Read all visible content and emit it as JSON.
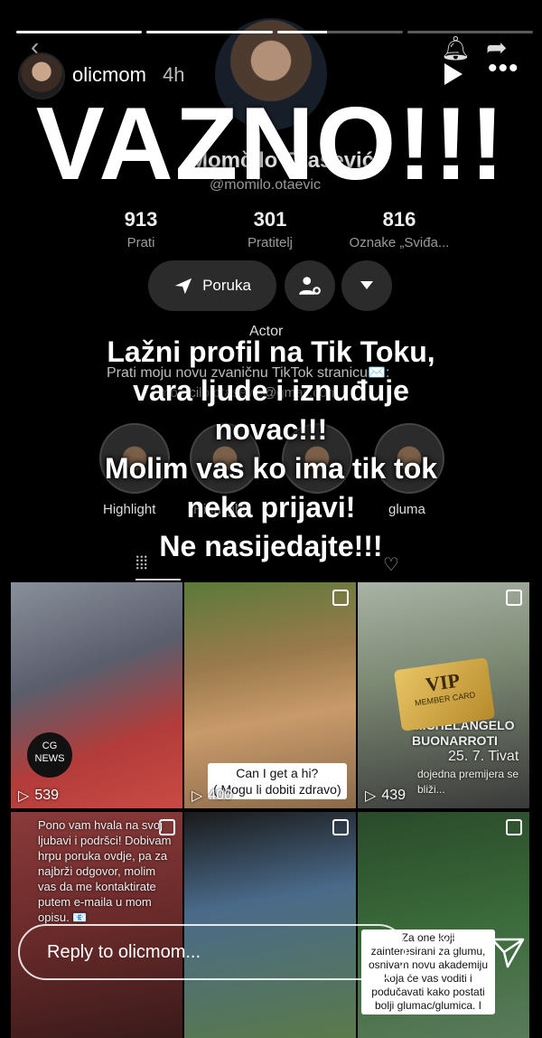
{
  "story": {
    "username": "olicmom",
    "time": "4h",
    "progress": [
      1,
      1,
      0.4,
      0
    ],
    "reply_placeholder": "Reply to olicmom..."
  },
  "overlay": {
    "title": "VAZNO!!!",
    "lines": [
      "Lažni profil na Tik Toku,",
      "vara ljude i iznuđuje",
      "novac!!!",
      "Molim vas ko ima tik tok",
      "neka prijavi!",
      "Ne nasijedajte!!!"
    ]
  },
  "tiktok_profile": {
    "name": "Momčilo Otašević",
    "handle": "@momilo.otaevic",
    "stats": [
      {
        "num": "913",
        "label": "Prati"
      },
      {
        "num": "301",
        "label": "Pratitelj"
      },
      {
        "num": "816",
        "label": "Oznake „Sviđa..."
      }
    ],
    "message_label": "Poruka",
    "category": "Actor",
    "bio": "Prati moju novu zvaničnu TikTok stranicu✉️:",
    "bio_link": "momcilo.otasevic@gmail.com",
    "highlights": [
      "Highlight",
      "Highlight",
      "",
      "gluma"
    ]
  },
  "grid": {
    "tiles": [
      {
        "views": "539"
      },
      {
        "views": "400",
        "caption": [
          "Can I get a hi?",
          "( Mogu li dobiti zdravo)"
        ]
      },
      {
        "views": "439",
        "card_title": "VIP",
        "card_sub": "MEMBER CARD",
        "sign": [
          "MICHELANGELO",
          "BUONARROTI"
        ],
        "footer": "25. 7. Tivat",
        "footer2": "dojedna premijera se bliži..."
      },
      {
        "caption": [
          "Pono vam hvala na svoj",
          "ljubavi i podršci! Dobivam",
          "hrpu poruka ovdje, pa za",
          "najbrži odgovor, molim",
          "vas da me kontaktirate",
          "putem e-maila u mom",
          "opisu. 📧"
        ]
      },
      {},
      {
        "caption": [
          "Za one koji",
          "zainteresirani za glumu,",
          "osnivam novu akademiju",
          "koja će vas voditi i",
          "podučavati kako postati",
          "bolji glumac/glumica. I"
        ]
      }
    ],
    "news_label": "CG NEWS"
  }
}
